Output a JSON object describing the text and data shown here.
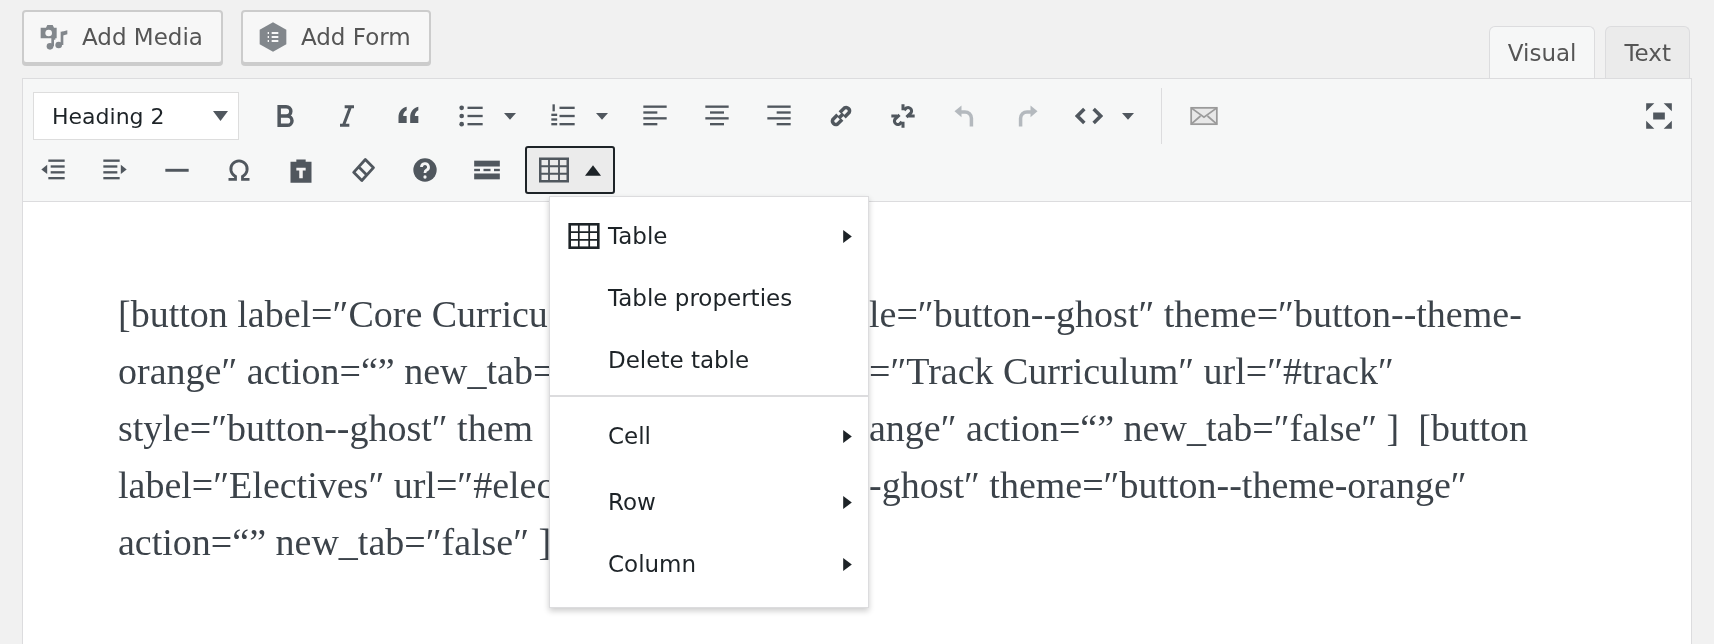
{
  "media_buttons": [
    {
      "label": "Add Media",
      "kind": "media"
    },
    {
      "label": "Add Form",
      "kind": "form"
    }
  ],
  "editor_tabs": [
    {
      "label": "Visual",
      "selected": true
    },
    {
      "label": "Text",
      "selected": false
    }
  ],
  "toolbar": {
    "format_select": {
      "value": "Heading 2"
    },
    "undo": {
      "disabled": true
    },
    "redo": {
      "disabled": true
    },
    "table_button": {
      "pressed": true
    }
  },
  "table_menu": [
    {
      "label": "Table",
      "kind": "table",
      "submenu": true,
      "separator_before": false
    },
    {
      "label": "Table properties",
      "kind": "plain",
      "submenu": false,
      "separator_before": false
    },
    {
      "label": "Delete table",
      "kind": "plain",
      "submenu": false,
      "separator_before": false
    },
    {
      "label": "Cell",
      "kind": "plain",
      "submenu": true,
      "separator_before": true
    },
    {
      "label": "Row",
      "kind": "plain",
      "submenu": true,
      "separator_before": false
    },
    {
      "label": "Column",
      "kind": "plain",
      "submenu": true,
      "separator_before": false
    }
  ],
  "content_lines": [
    {
      "left": "[button label=″Core Curricu",
      "right": "le=″button--ghost″ theme=″button--theme-"
    },
    {
      "left": "orange″ action=“” new_tab=",
      "right": "=″Track Curriculum″ url=″#track″"
    },
    {
      "left": "style=″button--ghost″ them",
      "right": "ange″ action=“” new_tab=″false″ ]  [button"
    },
    {
      "left": "label=″Electives″ url=″#elec",
      "right": "-ghost″ theme=″button--theme-orange″"
    },
    {
      "left": "action=“” new_tab=″false″ ]"
    }
  ]
}
